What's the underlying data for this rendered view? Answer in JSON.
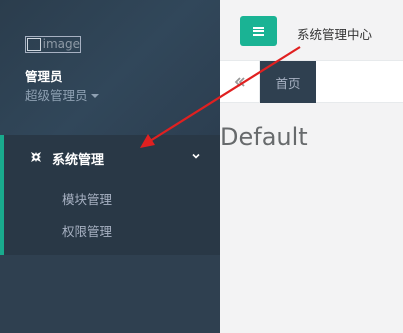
{
  "sidebar": {
    "avatar_alt": "image",
    "user_name": "管理员",
    "user_role": "超级管理员",
    "menu": {
      "group_label": "系统管理",
      "items": [
        {
          "label": "模块管理"
        },
        {
          "label": "权限管理"
        }
      ]
    }
  },
  "header": {
    "title": "系统管理中心"
  },
  "tabs": {
    "home_label": "首页"
  },
  "content": {
    "title": "Default"
  },
  "colors": {
    "sidebar_bg": "#2f4050",
    "accent": "#1ab394",
    "arrow": "#e02020"
  }
}
